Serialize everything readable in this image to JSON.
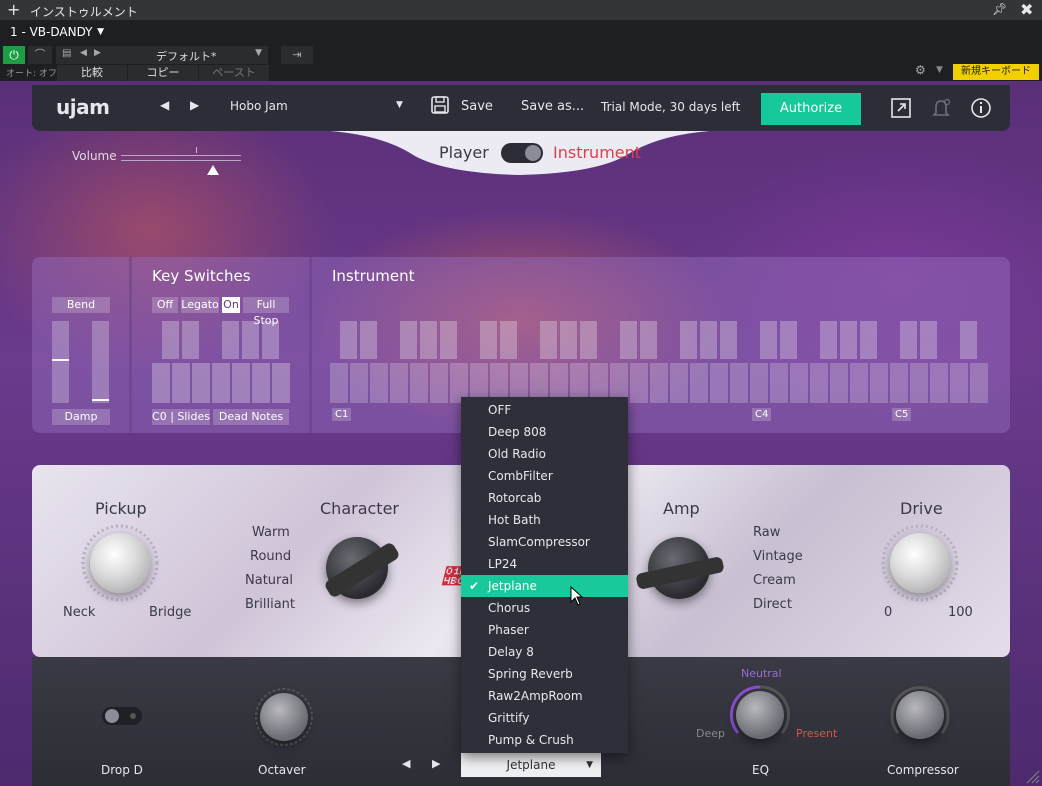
{
  "host": {
    "title": "インストゥルメント",
    "instrument_select": "1 - VB-DANDY",
    "preset": "デフォルト*",
    "auto_label": "オート: オフ",
    "compare": "比較",
    "copy": "コピー",
    "paste": "ペースト",
    "new_keyboard": "新規キーボード"
  },
  "topbar": {
    "logo": "ujam",
    "preset": "Hobo Jam",
    "save": "Save",
    "save_as": "Save as...",
    "trial": "Trial Mode, 30 days left",
    "authorize": "Authorize"
  },
  "mode": {
    "player": "Player",
    "instrument": "Instrument"
  },
  "volume": {
    "label": "Volume"
  },
  "keys": {
    "bend": "Bend",
    "damp": "Damp",
    "title": "Key Switches",
    "switches": [
      "Off",
      "Legato",
      "On",
      "Full Stop"
    ],
    "bottom": [
      "C0 | Slides",
      "Dead Notes"
    ],
    "instrument_title": "Instrument",
    "octaves": [
      "C1",
      "C4",
      "C5"
    ]
  },
  "controls": {
    "pickup": {
      "title": "Pickup",
      "left": "Neck",
      "right": "Bridge"
    },
    "character": {
      "title": "Character",
      "options": [
        "Warm",
        "Round",
        "Natural",
        "Brilliant"
      ]
    },
    "amp": {
      "title": "Amp",
      "options": [
        "Raw",
        "Vintage",
        "Cream",
        "Direct"
      ]
    },
    "drive": {
      "title": "Drive",
      "min": "0",
      "max": "100"
    }
  },
  "bottom": {
    "dropd": "Drop D",
    "octaver": "Octaver",
    "fx_selected": "Jetplane",
    "eq": "EQ",
    "eq_neutral": "Neutral",
    "eq_deep": "Deep",
    "eq_present": "Present",
    "compressor": "Compressor"
  },
  "fx_menu": {
    "items": [
      "OFF",
      "Deep 808",
      "Old Radio",
      "CombFilter",
      "Rotorcab",
      "Hot Bath",
      "SlamCompressor",
      "LP24",
      "Jetplane",
      "Chorus",
      "Phaser",
      "Delay 8",
      "Spring Reverb",
      "Raw2AmpRoom",
      "Grittify",
      "Pump & Crush"
    ],
    "selected": "Jetplane"
  },
  "colors": {
    "accent": "#15c99a",
    "instrument_red": "#d8434d",
    "eq_neutral": "#9b6ad8",
    "eq_present": "#e0504c"
  }
}
